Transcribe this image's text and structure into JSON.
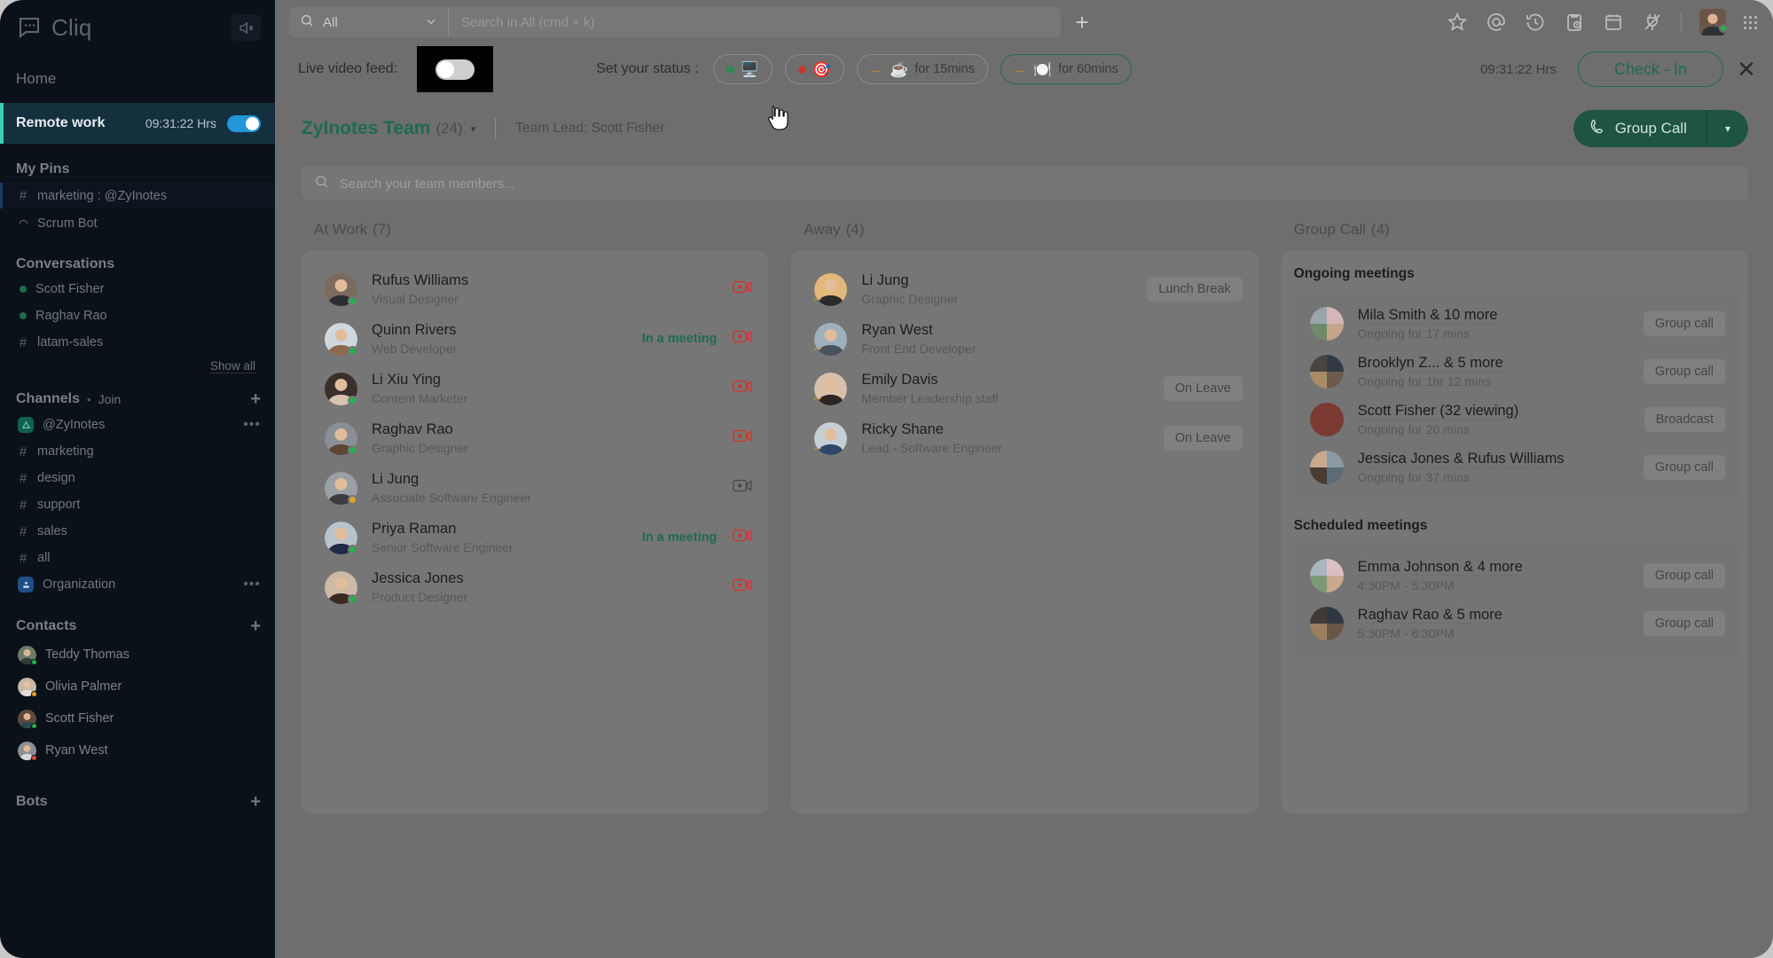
{
  "sidebar": {
    "brand": "Cliq",
    "mute_icon": "speaker-mute-icon",
    "home_label": "Home",
    "remote": {
      "label": "Remote work",
      "time": "09:31:22 Hrs"
    },
    "pins": {
      "title": "My Pins",
      "items": [
        {
          "icon": "hash-icon",
          "label": "marketing : @ZyInotes"
        },
        {
          "icon": "bot-icon",
          "label": "Scrum Bot"
        }
      ]
    },
    "conversations": {
      "title": "Conversations",
      "show_all": "Show all",
      "items": [
        {
          "icon": "status-dot-green",
          "label": "Scott Fisher"
        },
        {
          "icon": "status-dot-green",
          "label": "Raghav Rao"
        },
        {
          "icon": "hash-icon",
          "label": "latam-sales"
        }
      ]
    },
    "channels": {
      "title": "Channels",
      "sep": "•",
      "join": "Join",
      "add": "+",
      "items": [
        {
          "icon": "org-chip-icon",
          "label": "@ZyInotes",
          "more": "•••"
        },
        {
          "icon": "hash-icon",
          "label": "marketing"
        },
        {
          "icon": "hash-icon",
          "label": "design"
        },
        {
          "icon": "hash-icon",
          "label": "support"
        },
        {
          "icon": "hash-icon",
          "label": "sales"
        },
        {
          "icon": "hash-icon",
          "label": "all"
        },
        {
          "icon": "organization-chip-icon",
          "label": "Organization",
          "more": "•••"
        }
      ]
    },
    "contacts": {
      "title": "Contacts",
      "add": "+",
      "items": [
        {
          "label": "Teddy Thomas",
          "presence": "#24b24c"
        },
        {
          "label": "Olivia Palmer",
          "presence": "#e0a325"
        },
        {
          "label": "Scott Fisher",
          "presence": "#24b24c"
        },
        {
          "label": "Ryan West",
          "presence": "#d94b3c"
        }
      ]
    },
    "bots": {
      "title": "Bots",
      "add": "+"
    }
  },
  "topbar": {
    "scope_label": "All",
    "scope_icon": "search-icon",
    "chevron": "chevron-down-icon",
    "search_placeholder": "Search in All (cmd + k)",
    "search_value": "",
    "add_label": "+",
    "icons": [
      "star-icon",
      "at-mention-icon",
      "history-icon",
      "clipboard-clock-icon",
      "calendar-icon",
      "plug-icon"
    ],
    "apps_grid_icon": "apps-grid-icon"
  },
  "statusbar": {
    "live_video_label": "Live video feed:",
    "live_video_toggle_state": "off",
    "set_status_label": "Set your status :",
    "chips": [
      {
        "dot": "green",
        "emoji": "🖥️",
        "label": "",
        "selected": false
      },
      {
        "dot": "red",
        "emoji": "🎯",
        "label": "",
        "selected": false
      },
      {
        "dot": "",
        "emoji": "☕",
        "label": "for 15mins",
        "selected": false
      },
      {
        "dot": "",
        "emoji": "🍽️",
        "label": "for 60mins",
        "selected": true
      }
    ],
    "clock": "09:31:22 Hrs",
    "checkin_label": "Check - In",
    "close_label": "✕"
  },
  "team": {
    "name": "ZyInotes Team",
    "count": "(24)",
    "caret": "▾",
    "lead_prefix": "Team Lead:",
    "lead_name": "Scott Fisher",
    "group_call_label": "Group Call",
    "group_call_caret": "▾",
    "member_search_placeholder": "Search your team members..."
  },
  "columns": {
    "at_work": {
      "title": "At Work",
      "count": "(7)",
      "members": [
        {
          "name": "Rufus Williams",
          "role": "Visual Designer",
          "presence": "#24b24c",
          "status": "",
          "cam": "on",
          "face": [
            "#7b6b5e",
            "#2d2d33"
          ]
        },
        {
          "name": "Quinn Rivers",
          "role": "Web Developer",
          "presence": "#24b24c",
          "status": "In a meeting",
          "cam": "on",
          "face": [
            "#cfd8df",
            "#8d6a4e"
          ]
        },
        {
          "name": "Li Xiu Ying",
          "role": "Content Marketer",
          "presence": "#24b24c",
          "status": "",
          "cam": "on",
          "face": [
            "#3a2f2a",
            "#d7c3b0"
          ]
        },
        {
          "name": "Raghav Rao",
          "role": "Graphic Designer",
          "presence": "#24b24c",
          "status": "",
          "cam": "on",
          "face": [
            "#8a8f95",
            "#5b4636"
          ]
        },
        {
          "name": "Li Jung",
          "role": "Associate Software Engineer",
          "presence": "#e0a325",
          "status": "",
          "cam": "off",
          "face": [
            "#9aa0a6",
            "#3b3b40"
          ]
        },
        {
          "name": "Priya Raman",
          "role": "Senior Software Engineer",
          "presence": "#24b24c",
          "status": "In a meeting",
          "cam": "on",
          "face": [
            "#b9c3cb",
            "#1f2a44"
          ]
        },
        {
          "name": "Jessica Jones",
          "role": "Product Designer",
          "presence": "#24b24c",
          "status": "",
          "cam": "on",
          "face": [
            "#cdb9a6",
            "#3a2a22"
          ]
        }
      ]
    },
    "away": {
      "title": "Away",
      "count": "(4)",
      "members": [
        {
          "name": "Li Jung",
          "role": "Graphic Designer",
          "badge": "Lunch Break",
          "face": [
            "#e2b87a",
            "#2b2b2b"
          ]
        },
        {
          "name": "Ryan West",
          "role": "Front End Developer",
          "badge": "",
          "face": [
            "#9fb0bd",
            "#47525c"
          ]
        },
        {
          "name": "Emily Davis",
          "role": "Member Leadership staff",
          "badge": "On Leave",
          "face": [
            "#d8c0aa",
            "#2c2523"
          ]
        },
        {
          "name": "Ricky Shane",
          "role": "Lead - Software Engineer",
          "badge": "On Leave",
          "face": [
            "#c7cfd6",
            "#2f4668"
          ]
        }
      ]
    },
    "group_call": {
      "title": "Group Call",
      "count": "(4)",
      "ongoing_title": "Ongoing meetings",
      "ongoing": [
        {
          "name": "Mila Smith & 10 more",
          "sub": "Ongoing for 17 mins",
          "action": "Group call",
          "tiles": [
            "#9aa5ae",
            "#d4b6b7",
            "#6f8a6a",
            "#c3a58c"
          ]
        },
        {
          "name": "Brooklyn Z... & 5 more",
          "sub": "Ongoing for 1hr 12 mins",
          "action": "Group call",
          "tiles": [
            "#4a4440",
            "#2f3a45",
            "#a98b66",
            "#6d5a4c"
          ]
        },
        {
          "name": "Scott Fisher (32 viewing)",
          "sub": "Ongoing for 20 mins",
          "action": "Broadcast",
          "tiles": [
            "#7a3a32",
            "#7a3a32",
            "#7a3a32",
            "#7a3a32"
          ]
        },
        {
          "name": "Jessica Jones & Rufus Williams",
          "sub": "Ongoing for 37 mins",
          "action": "Group call",
          "tiles": [
            "#c8a98d",
            "#8a9aa6",
            "#4a3b30",
            "#5d6b74"
          ]
        }
      ],
      "scheduled_title": "Scheduled meetings",
      "scheduled": [
        {
          "name": "Emma Johnson & 4 more",
          "sub": "4:30PM - 5:30PM",
          "action": "Group call",
          "tiles": [
            "#a9b6c0",
            "#dbc0c2",
            "#7d9a76",
            "#c9a98e"
          ]
        },
        {
          "name": " Raghav Rao & 5 more",
          "sub": "5:30PM - 6:30PM",
          "action": "Group call",
          "tiles": [
            "#3f3a37",
            "#2e3842",
            "#9b7f5e",
            "#6a5647"
          ]
        }
      ]
    }
  }
}
